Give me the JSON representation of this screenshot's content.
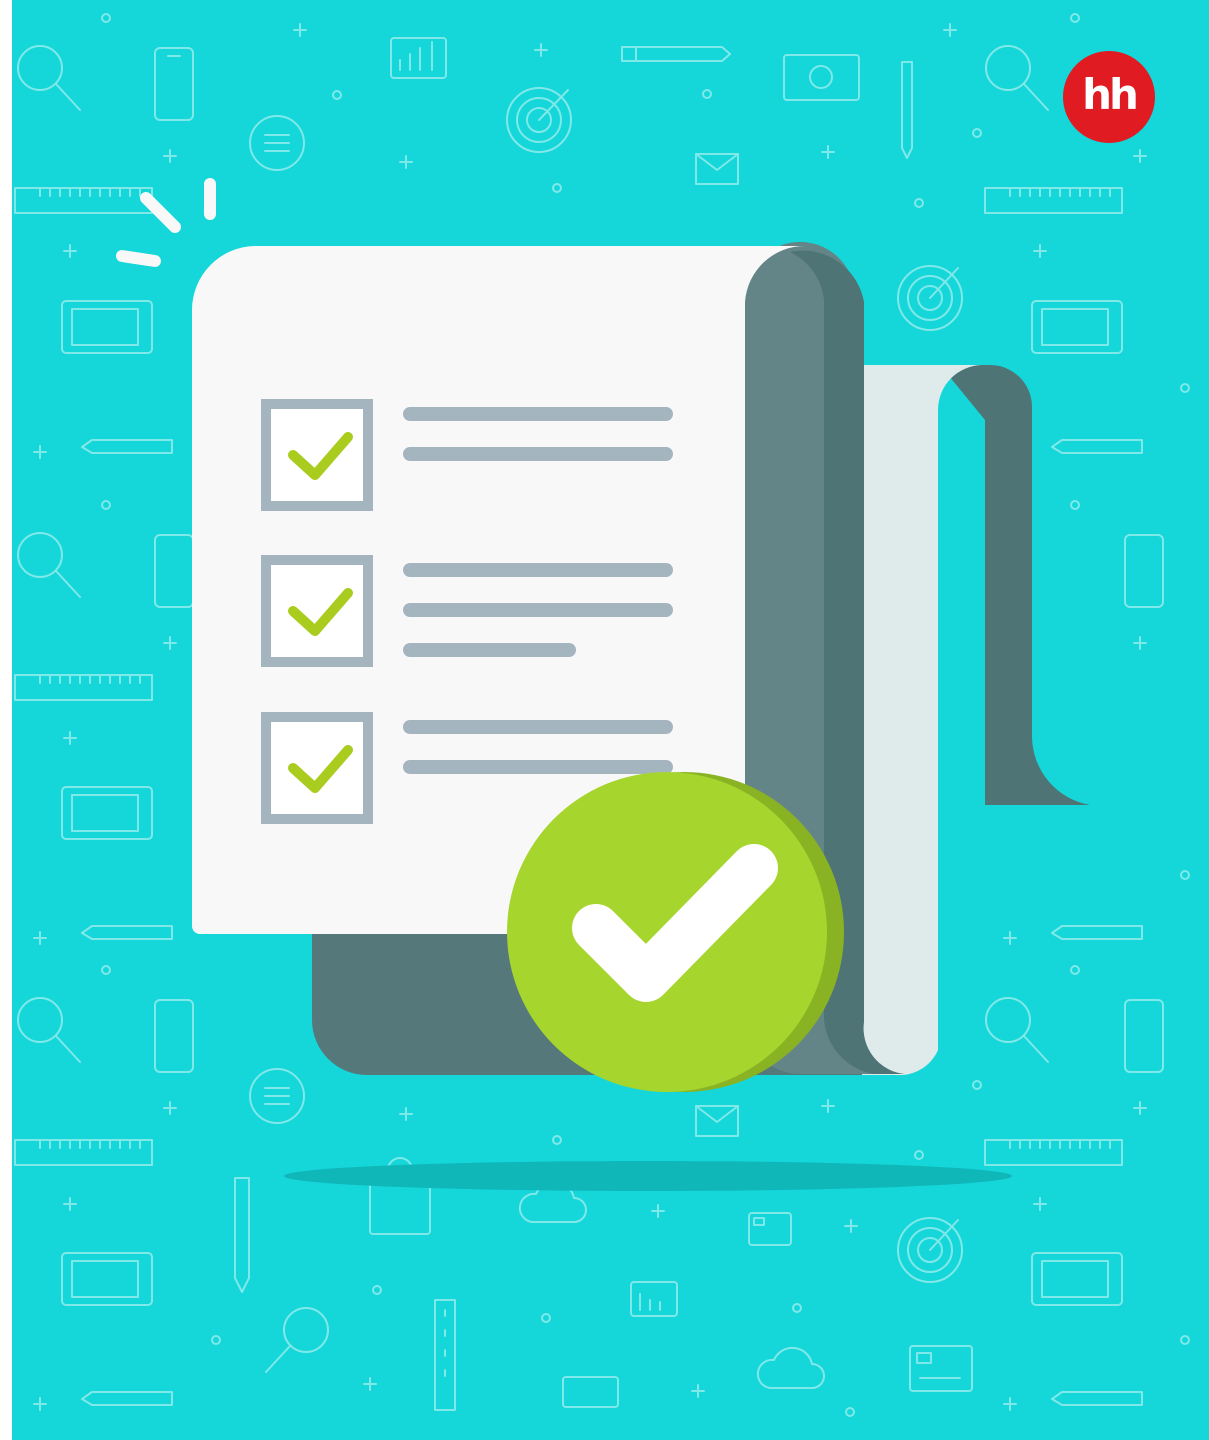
{
  "brand": {
    "logo_text": "hh",
    "logo_color": "#e01b22"
  },
  "colors": {
    "background": "#15d6d8",
    "pattern_stroke": "#7fe9ea",
    "paper": "#f8f8f8",
    "paper_shadow": "#55787a",
    "roll_dark": "#4f7476",
    "roll_mid": "#648587",
    "roll_light": "#dfeaea",
    "checkbox_border": "#a5b5c0",
    "check_mark": "#a9cc1f",
    "text_lines": "#a5b5c0",
    "badge_fill": "#a6d52e",
    "badge_shadow": "#8ab324",
    "floor_shadow": "#0fb7b9"
  },
  "checklist": {
    "items": [
      {
        "checked": true,
        "line_count": 2
      },
      {
        "checked": true,
        "line_count": 3
      },
      {
        "checked": true,
        "line_count": 2
      }
    ]
  },
  "icons": {
    "pattern": [
      "magnifier-icon",
      "phone-icon",
      "chart-icon",
      "pen-icon",
      "banknote-icon",
      "pencil-icon",
      "target-icon",
      "chat-icon",
      "envelope-icon",
      "ruler-icon",
      "tablet-icon",
      "cloud-icon",
      "card-icon",
      "bag-icon"
    ],
    "main": [
      "checklist-document-icon",
      "approved-checkmark-icon",
      "sparkle-icon"
    ]
  }
}
